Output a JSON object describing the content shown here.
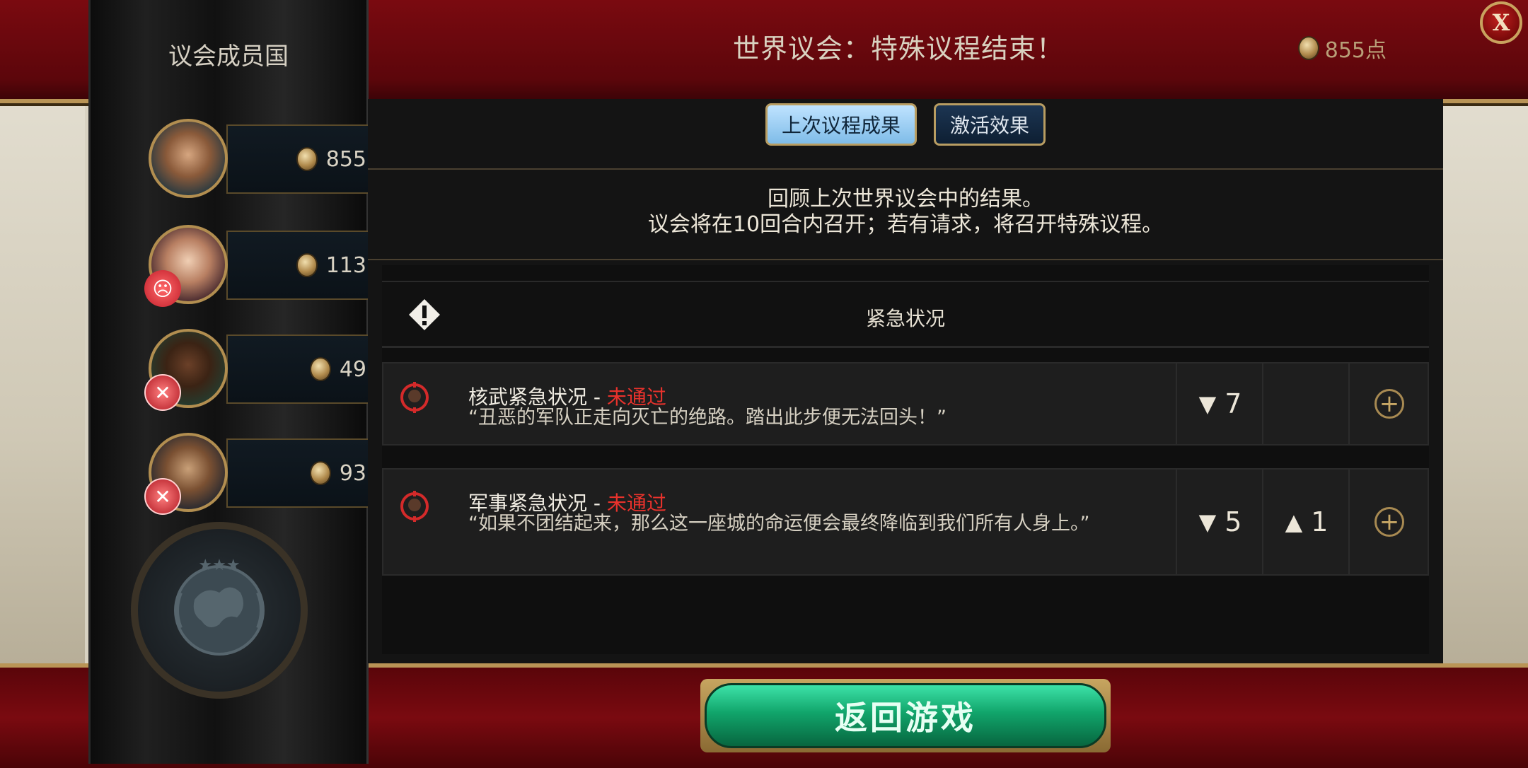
{
  "header": {
    "title": "世界议会：特殊议程结束！",
    "points": "855点",
    "close_label": "X"
  },
  "sidebar": {
    "title": "议会成员国",
    "members": [
      {
        "score": "855",
        "mood": ""
      },
      {
        "score": "113",
        "mood": "angry"
      },
      {
        "score": "49",
        "mood": "war"
      },
      {
        "score": "93",
        "mood": "war"
      }
    ]
  },
  "tabs": [
    {
      "label": "上次议程成果",
      "active": true
    },
    {
      "label": "激活效果",
      "active": false
    }
  ],
  "description": {
    "line1": "回顾上次世界议会中的结果。",
    "line2": "议会将在10回合内召开；若有请求，将召开特殊议程。"
  },
  "section": {
    "title": "紧急状况"
  },
  "resolutions": [
    {
      "name": "核武紧急状况",
      "separator": " - ",
      "status": "未通过",
      "quote": "“丑恶的军队正走向灭亡的绝路。踏出此步便无法回头！”",
      "votes_against": "7",
      "votes_for": ""
    },
    {
      "name": "军事紧急状况",
      "separator": " - ",
      "status": "未通过",
      "quote": "“如果不团结起来，那么这一座城的命运便会最终降临到我们所有人身上。”",
      "votes_against": "5",
      "votes_for": "1"
    }
  ],
  "footer": {
    "return_label": "返回游戏"
  },
  "colors": {
    "banner_red": "#7a0a10",
    "status_red": "#e8322c",
    "button_green": "#11a56b",
    "tab_active": "#bfe3ff"
  }
}
